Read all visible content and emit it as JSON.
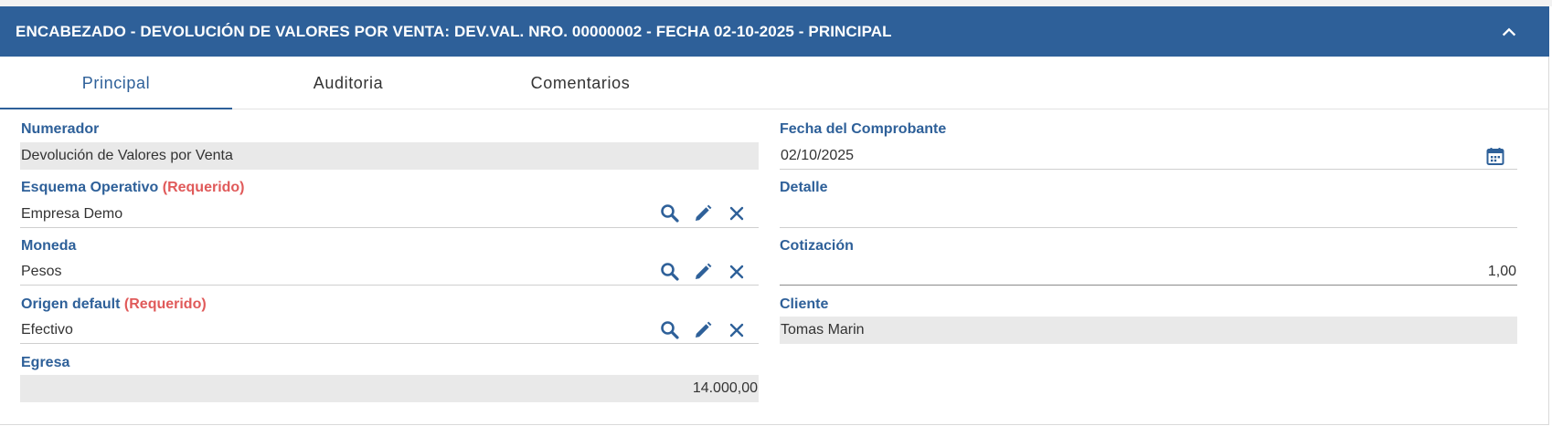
{
  "header": {
    "title": "ENCABEZADO - DEVOLUCIÓN DE VALORES POR VENTA: DEV.VAL. NRO. 00000002 - FECHA 02-10-2025 - PRINCIPAL"
  },
  "tabs": [
    {
      "label": "Principal",
      "active": true
    },
    {
      "label": "Auditoria",
      "active": false
    },
    {
      "label": "Comentarios",
      "active": false
    }
  ],
  "fields": {
    "numerador": {
      "label": "Numerador",
      "value": "Devolución de Valores por Venta"
    },
    "esquema": {
      "label": "Esquema Operativo",
      "required": "(Requerido)",
      "value": "Empresa Demo"
    },
    "moneda": {
      "label": "Moneda",
      "value": "Pesos"
    },
    "origen": {
      "label": "Origen default",
      "required": "(Requerido)",
      "value": "Efectivo"
    },
    "egresa": {
      "label": "Egresa",
      "value": "14.000,00"
    },
    "fecha": {
      "label": "Fecha del Comprobante",
      "value": "02/10/2025"
    },
    "detalle": {
      "label": "Detalle",
      "value": ""
    },
    "cotizacion": {
      "label": "Cotización",
      "value": "1,00"
    },
    "cliente": {
      "label": "Cliente",
      "value": "Tomas Marin"
    }
  },
  "icons": {
    "collapse": "chevron-up-icon",
    "search": "search-icon",
    "edit": "pencil-icon",
    "clear": "close-icon",
    "calendar": "calendar-icon"
  },
  "colors": {
    "header_bg": "#2e6099",
    "label": "#2e6099",
    "required": "#e05a5a",
    "readonly_bg": "#e9e9e9"
  }
}
